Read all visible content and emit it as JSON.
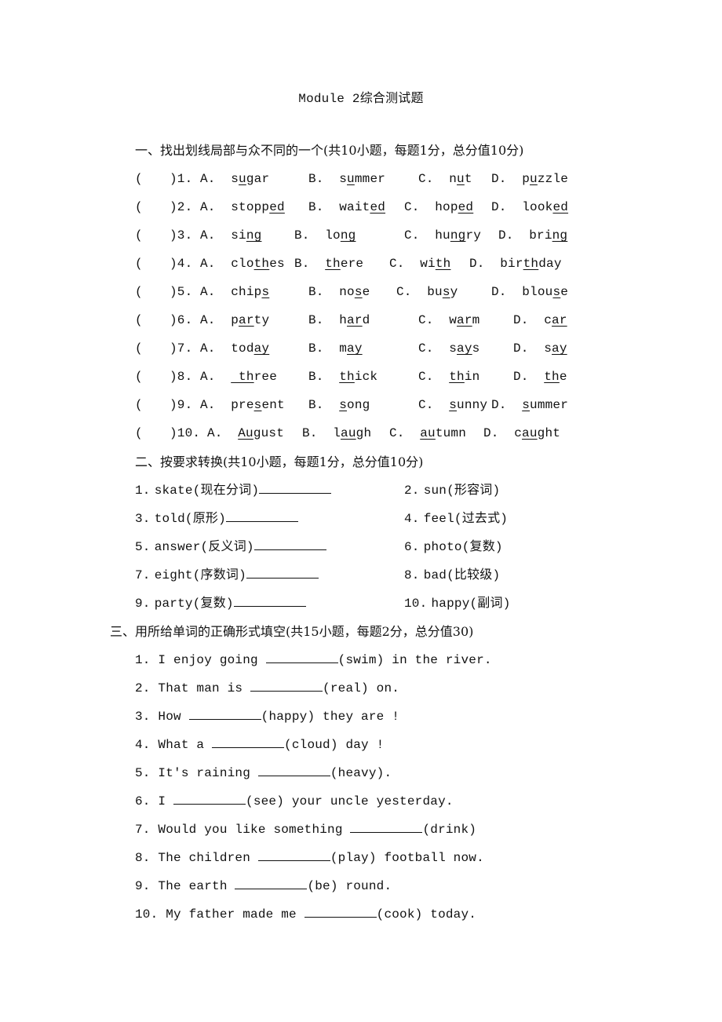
{
  "title": "Module 2综合测试题",
  "section1": {
    "heading": "一、找出划线局部与众不同的一个(共10小题，每题1分，总分值10分)",
    "questions": [
      {
        "num": ")1.",
        "options": [
          {
            "letter": "A.",
            "pre": "s",
            "u": "u",
            "post": "gar"
          },
          {
            "letter": "B.",
            "pre": "s",
            "u": "u",
            "post": "mmer"
          },
          {
            "letter": "C.",
            "pre": "n",
            "u": "u",
            "post": "t"
          },
          {
            "letter": "D.",
            "pre": "p",
            "u": "u",
            "post": "zzle"
          }
        ]
      },
      {
        "num": ")2.",
        "options": [
          {
            "letter": "A.",
            "pre": "stopp",
            "u": "ed",
            "post": ""
          },
          {
            "letter": "B.",
            "pre": "wait",
            "u": "ed",
            "post": ""
          },
          {
            "letter": "C.",
            "pre": "hop",
            "u": "ed",
            "post": ""
          },
          {
            "letter": "D.",
            "pre": "look",
            "u": "ed",
            "post": ""
          }
        ]
      },
      {
        "num": ")3.",
        "options": [
          {
            "letter": "A.",
            "pre": "si",
            "u": "ng",
            "post": ""
          },
          {
            "letter": "B.",
            "pre": "lo",
            "u": "ng",
            "post": ""
          },
          {
            "letter": "C.",
            "pre": "hu",
            "u": "ng",
            "post": "ry"
          },
          {
            "letter": "D.",
            "pre": "bri",
            "u": "ng",
            "post": ""
          }
        ]
      },
      {
        "num": ")4.",
        "options": [
          {
            "letter": "A.",
            "pre": "clo",
            "u": "th",
            "post": "es"
          },
          {
            "letter": "B.",
            "pre": "",
            "u": "th",
            "post": "ere"
          },
          {
            "letter": "C.",
            "pre": "wi",
            "u": "th",
            "post": ""
          },
          {
            "letter": "D.",
            "pre": "bir",
            "u": "th",
            "post": "day"
          }
        ]
      },
      {
        "num": ")5.",
        "options": [
          {
            "letter": "A.",
            "pre": "chip",
            "u": "s",
            "post": ""
          },
          {
            "letter": "B.",
            "pre": "no",
            "u": "s",
            "post": "e"
          },
          {
            "letter": "C.",
            "pre": "bu",
            "u": "s",
            "post": "y"
          },
          {
            "letter": "D.",
            "pre": "blou",
            "u": "s",
            "post": "e"
          }
        ]
      },
      {
        "num": ")6.",
        "options": [
          {
            "letter": "A.",
            "pre": "p",
            "u": "ar",
            "post": "ty"
          },
          {
            "letter": "B.",
            "pre": "h",
            "u": "ar",
            "post": "d"
          },
          {
            "letter": "C.",
            "pre": "w",
            "u": "ar",
            "post": "m"
          },
          {
            "letter": "D.",
            "pre": "c",
            "u": "ar",
            "post": ""
          }
        ]
      },
      {
        "num": ")7.",
        "options": [
          {
            "letter": "A.",
            "pre": "tod",
            "u": "ay",
            "post": ""
          },
          {
            "letter": "B.",
            "pre": "m",
            "u": "ay",
            "post": ""
          },
          {
            "letter": "C.",
            "pre": "s",
            "u": "ay",
            "post": "s"
          },
          {
            "letter": "D.",
            "pre": "s",
            "u": "ay",
            "post": ""
          }
        ]
      },
      {
        "num": ")8.",
        "options": [
          {
            "letter": "A.",
            "pre": "",
            "u": " th",
            "post": "ree"
          },
          {
            "letter": "B.",
            "pre": "",
            "u": "th",
            "post": "ick"
          },
          {
            "letter": "C.",
            "pre": "",
            "u": "th",
            "post": "in"
          },
          {
            "letter": "D.",
            "pre": "",
            "u": "th",
            "post": "e"
          }
        ]
      },
      {
        "num": ")9.",
        "options": [
          {
            "letter": "A.",
            "pre": "pre",
            "u": "s",
            "post": "ent"
          },
          {
            "letter": "B.",
            "pre": "",
            "u": "s",
            "post": "ong"
          },
          {
            "letter": "C.",
            "pre": "",
            "u": "s",
            "post": "unny"
          },
          {
            "letter": "D.",
            "pre": "",
            "u": "s",
            "post": "ummer"
          }
        ]
      },
      {
        "num": ")10.",
        "options": [
          {
            "letter": "A.",
            "pre": "",
            "u": "Au",
            "post": "gust"
          },
          {
            "letter": "B.",
            "pre": "l",
            "u": "au",
            "post": "gh"
          },
          {
            "letter": "C.",
            "pre": "",
            "u": "au",
            "post": "tumn"
          },
          {
            "letter": "D.",
            "pre": "c",
            "u": "au",
            "post": "ght"
          }
        ]
      }
    ]
  },
  "section2": {
    "heading": "二、按要求转换(共10小题，每题1分，总分值10分)",
    "items": [
      {
        "num": "1.",
        "text": "skate(现在分词)",
        "blank": true
      },
      {
        "num": "2.",
        "text": "sun(形容词)",
        "blank": false
      },
      {
        "num": "3.",
        "text": "told(原形)",
        "blank": true
      },
      {
        "num": "4.",
        "text": "feel(过去式)",
        "blank": false
      },
      {
        "num": "5.",
        "text": "answer(反义词)",
        "blank": true
      },
      {
        "num": "6.",
        "text": "photo(复数)",
        "blank": false
      },
      {
        "num": "7.",
        "text": "eight(序数词)",
        "blank": true
      },
      {
        "num": "8.",
        "text": "bad(比较级)",
        "blank": false
      },
      {
        "num": "9.",
        "text": "party(复数)",
        "blank": true
      },
      {
        "num": "10.",
        "text": "happy(副词)",
        "blank": false
      }
    ]
  },
  "section3": {
    "heading": "三、用所给单词的正确形式填空(共15小题，每题2分，总分值30)",
    "items": [
      {
        "num": "1.",
        "before": "I enjoy going ",
        "after": "(swim) in the river."
      },
      {
        "num": "2.",
        "before": "That man is ",
        "after": "(real) on."
      },
      {
        "num": "3.",
        "before": "How ",
        "after": "(happy) they are !"
      },
      {
        "num": "4.",
        "before": "What a ",
        "after": "(cloud) day !"
      },
      {
        "num": "5.",
        "before": "It's raining ",
        "after": "(heavy)."
      },
      {
        "num": "6.",
        "before": "I ",
        "after": "(see) your uncle yesterday."
      },
      {
        "num": "7.",
        "before": "Would you like something ",
        "after": "(drink)"
      },
      {
        "num": "8.",
        "before": "The children ",
        "after": "(play) football now."
      },
      {
        "num": "9.",
        "before": "The earth ",
        "after": "(be) round."
      },
      {
        "num": "10.",
        "before": "My father made me ",
        "after": "(cook) today."
      }
    ]
  }
}
